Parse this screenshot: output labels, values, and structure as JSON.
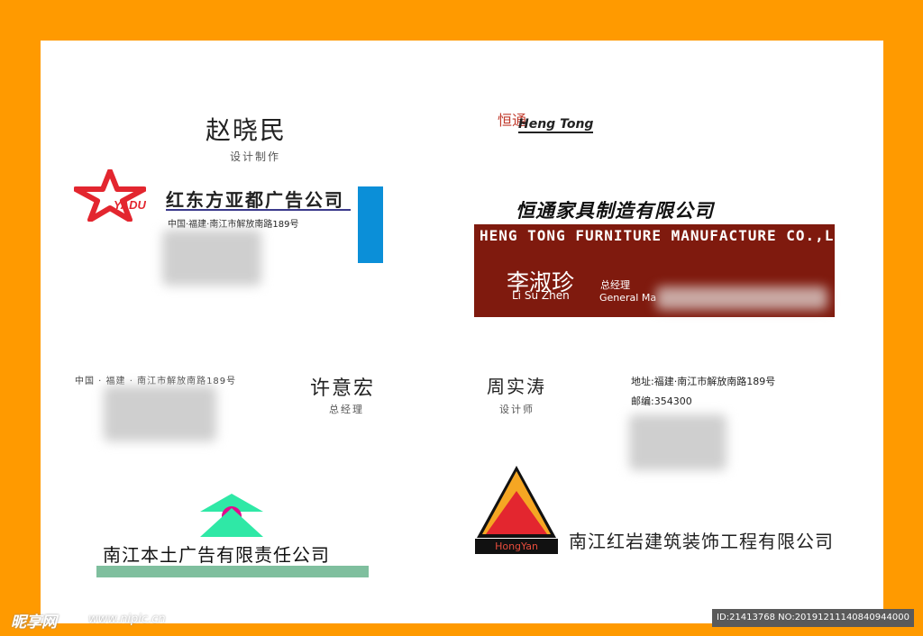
{
  "card1": {
    "name": "赵晓民",
    "title": "设计制作",
    "logo_text": "YADU",
    "company": "红东方亚都广告公司",
    "address": "中国·福建·南江市解放南路189号"
  },
  "card2": {
    "logo_cn": "恒通",
    "logo_en": "Heng Tong",
    "company_cn": "恒通家具制造有限公司",
    "company_en": "HENG TONG FURNITURE MANUFACTURE CO.,LTD.",
    "name_cn": "李淑珍",
    "name_en": "Li Su Zhen",
    "role_cn": "总经理",
    "role_en": "General Ma"
  },
  "card3": {
    "address": "中国 · 福建 · 南江市解放南路189号",
    "name": "许意宏",
    "title": "总经理",
    "company": "南江本土广告有限责任公司"
  },
  "card4": {
    "name": "周实涛",
    "title": "设计师",
    "address": "地址:福建·南江市解放南路189号",
    "zip": "邮编:354300",
    "logo_label": "HongYan",
    "company": "南江红岩建筑装饰工程有限公司"
  },
  "watermark": {
    "site_name": "昵享网",
    "site_url": "www.nipic.cn",
    "id_text": "ID:21413768 NO:20191211140840944000"
  },
  "colors": {
    "frame": "#ff9a00",
    "blue_bar": "#0b8fd8",
    "maroon_band": "#7f1a0e",
    "green_band": "#7fbf9e",
    "logo_red": "#e3262f"
  }
}
